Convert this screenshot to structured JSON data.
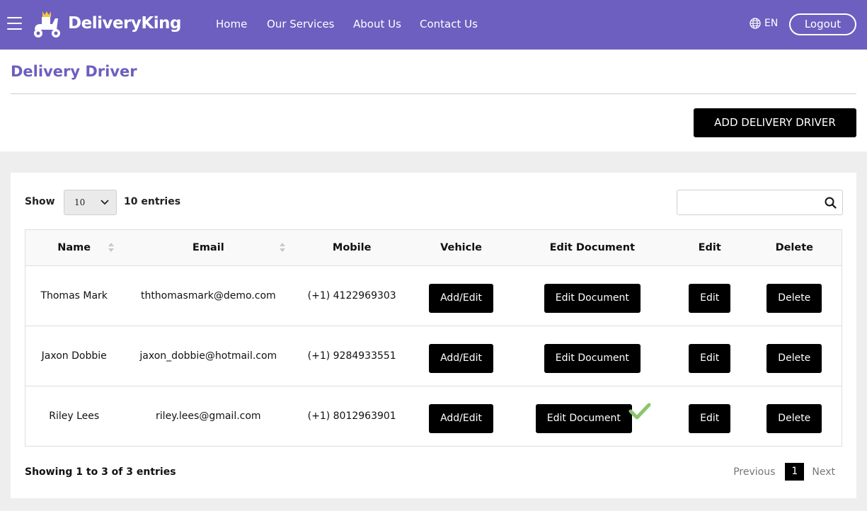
{
  "nav": {
    "brand": "DeliveryKing",
    "links": [
      "Home",
      "Our Services",
      "About Us",
      "Contact Us"
    ],
    "language": "EN",
    "logout_label": "Logout",
    "color": "#6c5fbf"
  },
  "page": {
    "title": "Delivery Driver",
    "add_button": "ADD DELIVERY DRIVER"
  },
  "table_controls": {
    "show_label": "Show",
    "page_size": "10",
    "entries_label": "10 entries",
    "search_placeholder": ""
  },
  "table": {
    "headers": [
      "Name",
      "Email",
      "Mobile",
      "Vehicle",
      "Edit Document",
      "Edit",
      "Delete"
    ],
    "rows": [
      {
        "name": "Thomas Mark",
        "email": "ththomasmark@demo.com",
        "mobile": "(+1) 4122969303",
        "vehicle": "Add/Edit",
        "document": "Edit Document",
        "edit": "Edit",
        "delete": "Delete",
        "verified": false
      },
      {
        "name": "Jaxon Dobbie",
        "email": "jaxon_dobbie@hotmail.com",
        "mobile": "(+1) 9284933551",
        "vehicle": "Add/Edit",
        "document": "Edit Document",
        "edit": "Edit",
        "delete": "Delete",
        "verified": false
      },
      {
        "name": "Riley Lees",
        "email": "riley.lees@gmail.com",
        "mobile": "(+1) 8012963901",
        "vehicle": "Add/Edit",
        "document": "Edit Document",
        "edit": "Edit",
        "delete": "Delete",
        "verified": true
      }
    ]
  },
  "footer": {
    "showing": "Showing 1 to 3 of 3 entries",
    "previous": "Previous",
    "current_page": "1",
    "next": "Next"
  }
}
